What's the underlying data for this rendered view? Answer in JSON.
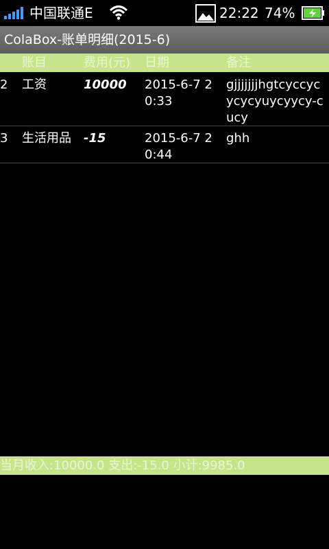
{
  "status_bar": {
    "carrier": "中国联通E",
    "time": "22:22",
    "battery": "74%"
  },
  "app": {
    "title": "ColaBox-账单明细(2015-6)"
  },
  "table": {
    "headers": {
      "category": "账目",
      "amount": "费用(元)",
      "date": "日期",
      "note": "备注"
    },
    "rows": [
      {
        "index": "2",
        "category": "工资",
        "amount": "10000",
        "date": "2015-6-7 20:33",
        "note": "gjjjjjjjhgtcyccycycycyuycyycy-cucy"
      },
      {
        "index": "3",
        "category": "生活用品",
        "amount": "-15",
        "date": "2015-6-7 20:44",
        "note": "ghh"
      }
    ]
  },
  "summary": {
    "text": "当月收入:10000.0 支出:-15.0 小计:9985.0"
  },
  "colors": {
    "accent_green": "#c6e48b",
    "signal_blue": "#3f9bff",
    "battery_green": "#5fd33a"
  }
}
